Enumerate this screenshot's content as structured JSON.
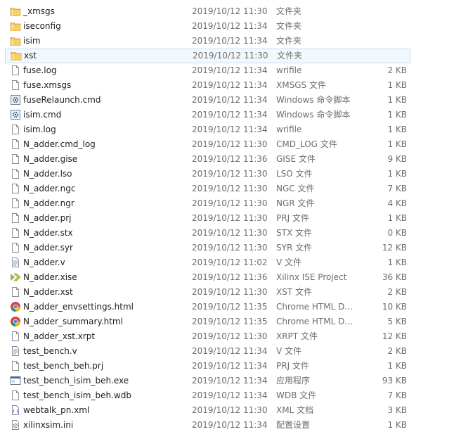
{
  "files": [
    {
      "name": "_xmsgs",
      "date": "2019/10/12 11:30",
      "type": "文件夹",
      "size": "",
      "icon": "folder-icon"
    },
    {
      "name": "iseconfig",
      "date": "2019/10/12 11:34",
      "type": "文件夹",
      "size": "",
      "icon": "folder-icon"
    },
    {
      "name": "isim",
      "date": "2019/10/12 11:34",
      "type": "文件夹",
      "size": "",
      "icon": "folder-icon"
    },
    {
      "name": "xst",
      "date": "2019/10/12 11:30",
      "type": "文件夹",
      "size": "",
      "icon": "folder-icon",
      "selected": true
    },
    {
      "name": "fuse.log",
      "date": "2019/10/12 11:34",
      "type": "wrifile",
      "size": "2 KB",
      "icon": "document-icon"
    },
    {
      "name": "fuse.xmsgs",
      "date": "2019/10/12 11:34",
      "type": "XMSGS 文件",
      "size": "1 KB",
      "icon": "document-icon"
    },
    {
      "name": "fuseRelaunch.cmd",
      "date": "2019/10/12 11:34",
      "type": "Windows 命令脚本",
      "size": "1 KB",
      "icon": "gear-script-icon"
    },
    {
      "name": "isim.cmd",
      "date": "2019/10/12 11:34",
      "type": "Windows 命令脚本",
      "size": "1 KB",
      "icon": "gear-script-icon"
    },
    {
      "name": "isim.log",
      "date": "2019/10/12 11:34",
      "type": "wrifile",
      "size": "1 KB",
      "icon": "document-icon"
    },
    {
      "name": "N_adder.cmd_log",
      "date": "2019/10/12 11:30",
      "type": "CMD_LOG 文件",
      "size": "1 KB",
      "icon": "document-icon"
    },
    {
      "name": "N_adder.gise",
      "date": "2019/10/12 11:36",
      "type": "GISE 文件",
      "size": "9 KB",
      "icon": "document-icon"
    },
    {
      "name": "N_adder.lso",
      "date": "2019/10/12 11:30",
      "type": "LSO 文件",
      "size": "1 KB",
      "icon": "document-icon"
    },
    {
      "name": "N_adder.ngc",
      "date": "2019/10/12 11:30",
      "type": "NGC 文件",
      "size": "7 KB",
      "icon": "document-icon"
    },
    {
      "name": "N_adder.ngr",
      "date": "2019/10/12 11:30",
      "type": "NGR 文件",
      "size": "4 KB",
      "icon": "document-icon"
    },
    {
      "name": "N_adder.prj",
      "date": "2019/10/12 11:30",
      "type": "PRJ 文件",
      "size": "1 KB",
      "icon": "document-icon"
    },
    {
      "name": "N_adder.stx",
      "date": "2019/10/12 11:30",
      "type": "STX 文件",
      "size": "0 KB",
      "icon": "document-icon"
    },
    {
      "name": "N_adder.syr",
      "date": "2019/10/12 11:30",
      "type": "SYR 文件",
      "size": "12 KB",
      "icon": "document-icon"
    },
    {
      "name": "N_adder.v",
      "date": "2019/10/12 11:02",
      "type": "V 文件",
      "size": "1 KB",
      "icon": "text-file-icon"
    },
    {
      "name": "N_adder.xise",
      "date": "2019/10/12 11:36",
      "type": "Xilinx ISE Project",
      "size": "36 KB",
      "icon": "xilinx-icon"
    },
    {
      "name": "N_adder.xst",
      "date": "2019/10/12 11:30",
      "type": "XST 文件",
      "size": "2 KB",
      "icon": "document-icon"
    },
    {
      "name": "N_adder_envsettings.html",
      "date": "2019/10/12 11:35",
      "type": "Chrome HTML D...",
      "size": "10 KB",
      "icon": "chrome-icon"
    },
    {
      "name": "N_adder_summary.html",
      "date": "2019/10/12 11:35",
      "type": "Chrome HTML D...",
      "size": "5 KB",
      "icon": "chrome-icon"
    },
    {
      "name": "N_adder_xst.xrpt",
      "date": "2019/10/12 11:30",
      "type": "XRPT 文件",
      "size": "12 KB",
      "icon": "document-icon"
    },
    {
      "name": "test_bench.v",
      "date": "2019/10/12 11:34",
      "type": "V 文件",
      "size": "2 KB",
      "icon": "text-file-icon"
    },
    {
      "name": "test_bench_beh.prj",
      "date": "2019/10/12 11:34",
      "type": "PRJ 文件",
      "size": "1 KB",
      "icon": "document-icon"
    },
    {
      "name": "test_bench_isim_beh.exe",
      "date": "2019/10/12 11:34",
      "type": "应用程序",
      "size": "93 KB",
      "icon": "exe-icon"
    },
    {
      "name": "test_bench_isim_beh.wdb",
      "date": "2019/10/12 11:34",
      "type": "WDB 文件",
      "size": "7 KB",
      "icon": "document-icon"
    },
    {
      "name": "webtalk_pn.xml",
      "date": "2019/10/12 11:30",
      "type": "XML 文档",
      "size": "3 KB",
      "icon": "xml-icon"
    },
    {
      "name": "xilinxsim.ini",
      "date": "2019/10/12 11:34",
      "type": "配置设置",
      "size": "1 KB",
      "icon": "ini-settings-icon"
    }
  ],
  "colors": {
    "folder": "#e8b84a",
    "selection_bg": "#f3f8fd",
    "selection_border": "#c6dcf2",
    "secondary_text": "#6d6d6d",
    "xilinx": "#9ab23c"
  }
}
